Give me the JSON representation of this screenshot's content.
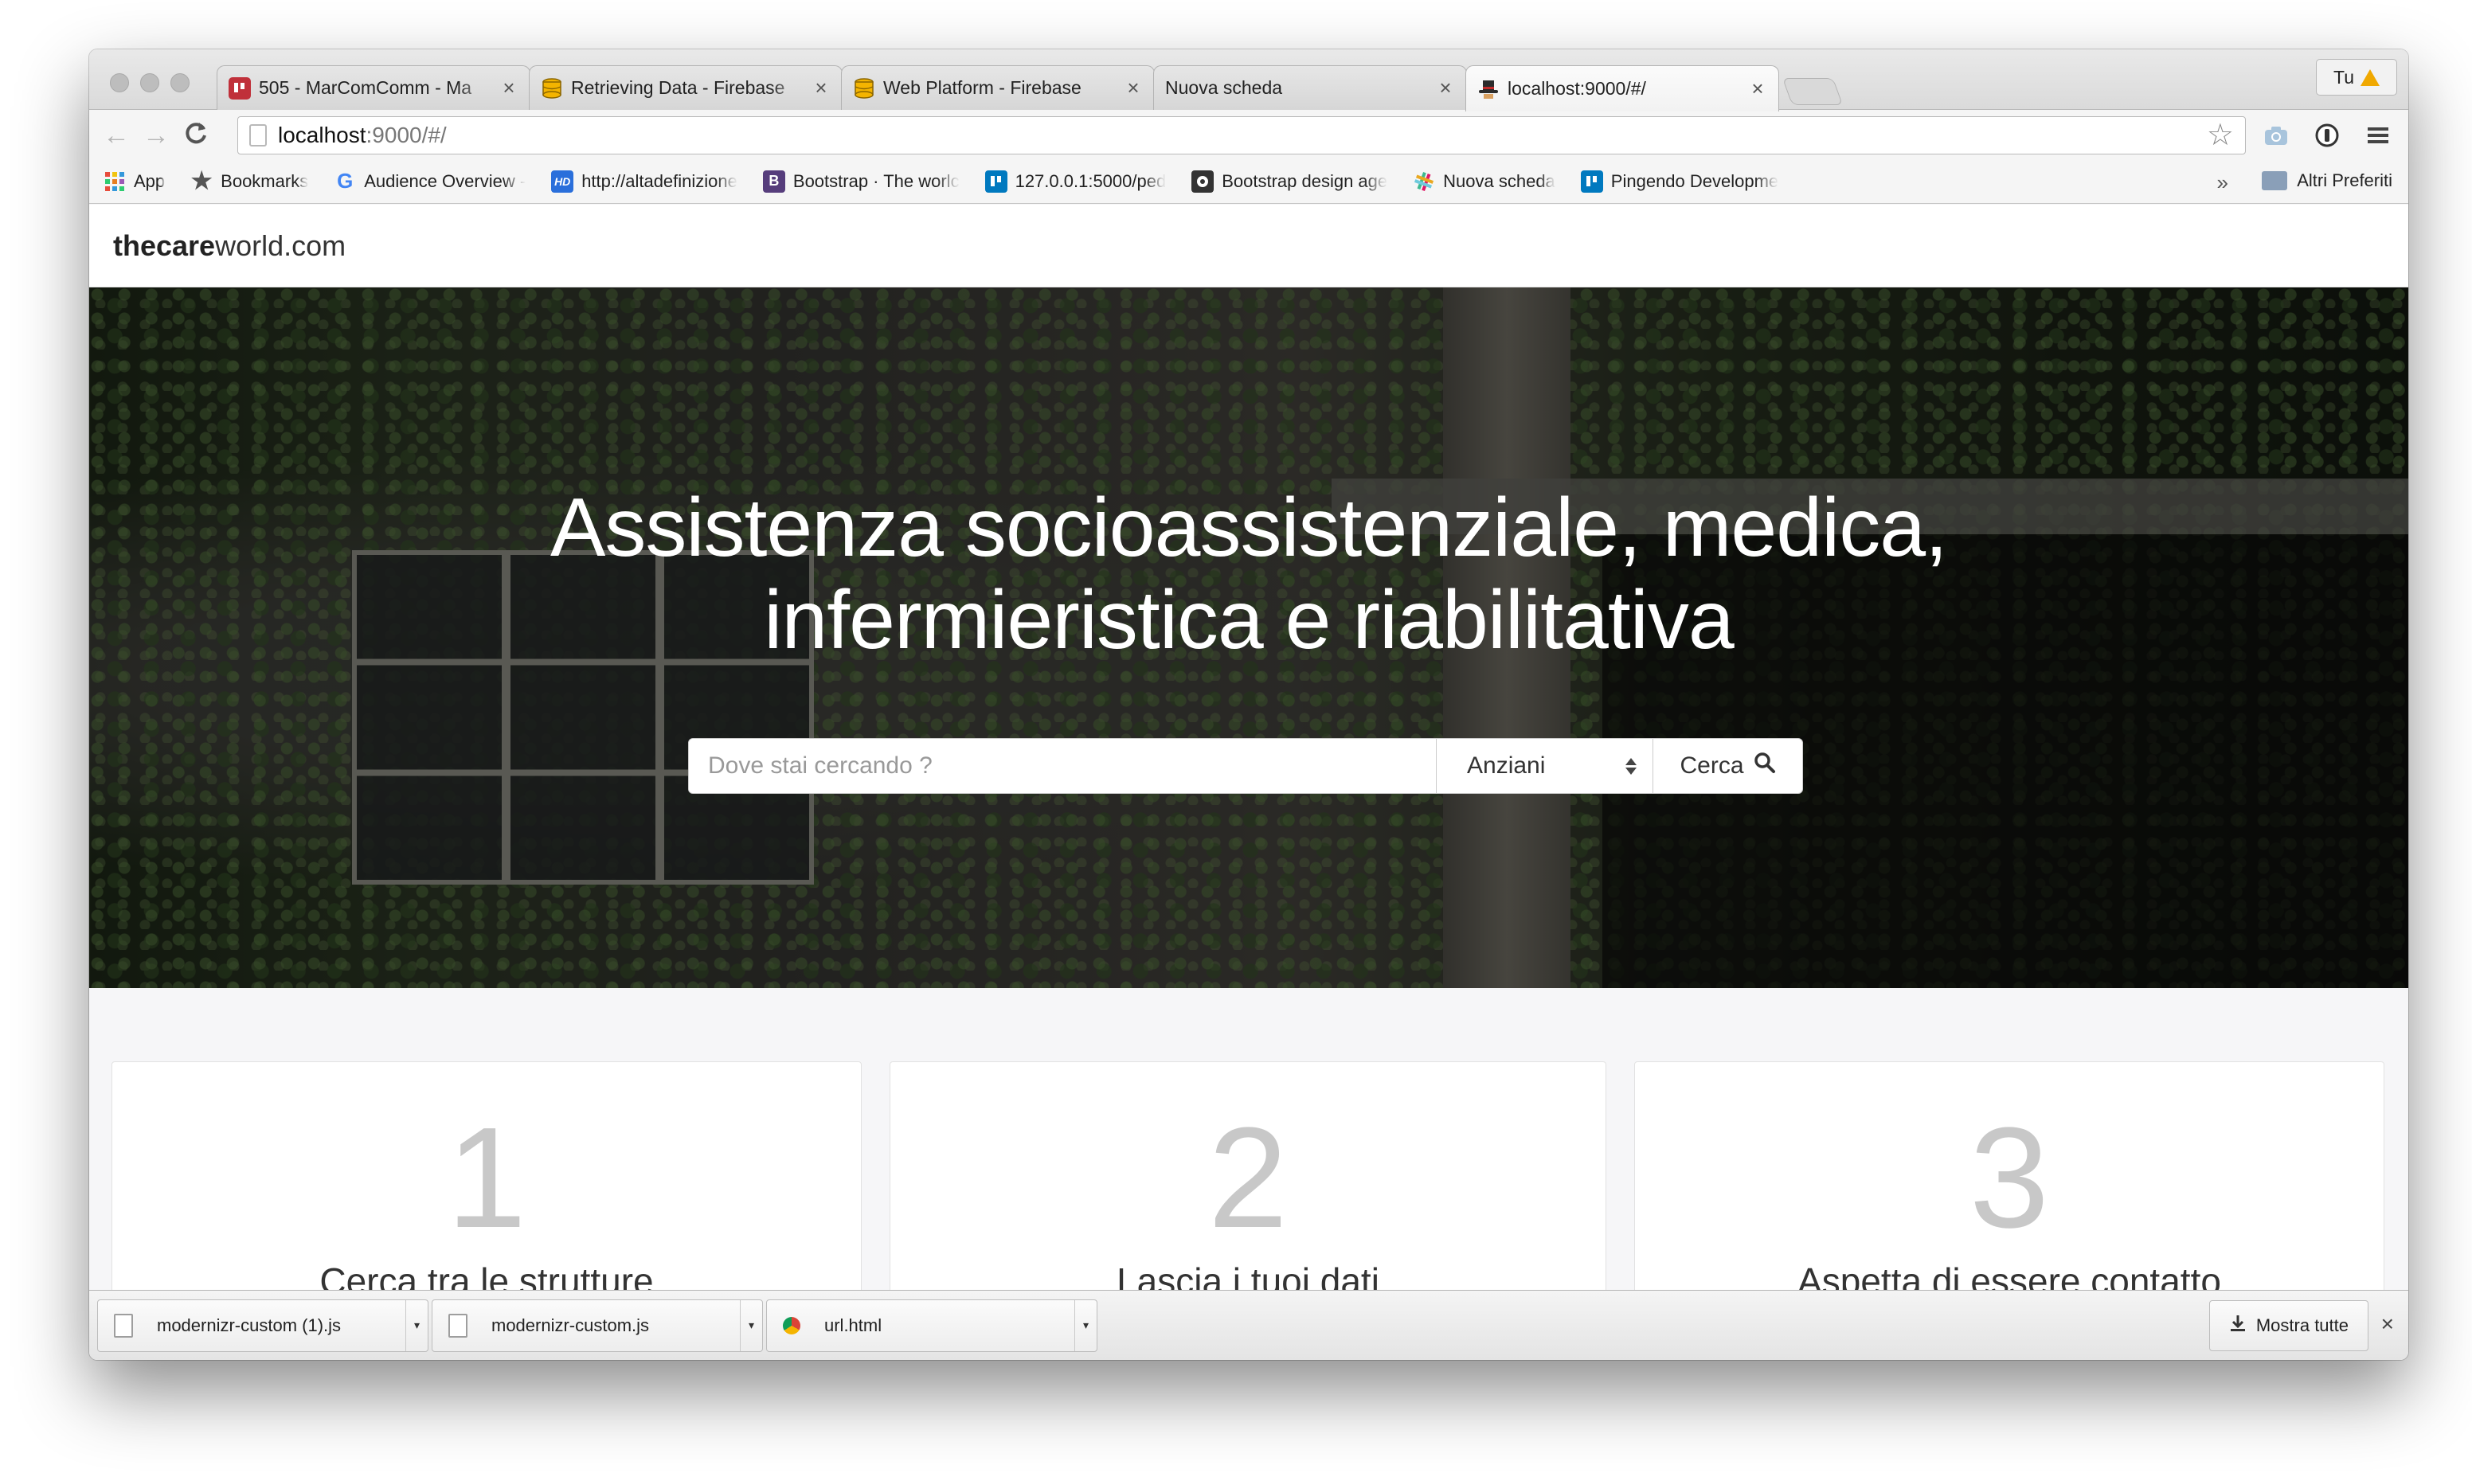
{
  "browser": {
    "tabs": [
      {
        "title": "505 - MarComComm - Ma",
        "favicon": "trello-icon",
        "color": "#c0303a",
        "active": false
      },
      {
        "title": "Retrieving Data - Firebase",
        "favicon": "firebase-icon",
        "color": "#f4b400",
        "active": false
      },
      {
        "title": "Web Platform - Firebase",
        "favicon": "firebase-icon",
        "color": "#f4b400",
        "active": false
      },
      {
        "title": "Nuova scheda",
        "favicon": "",
        "color": "",
        "active": false
      },
      {
        "title": "localhost:9000/#/",
        "favicon": "hat-icon",
        "color": "#c42a2a",
        "active": true
      }
    ],
    "profile_label": "Tu",
    "url_host": "localhost",
    "url_rest": ":9000/#/",
    "bookmarks": [
      {
        "label": "App",
        "icon": "apps-grid-icon"
      },
      {
        "label": "Bookmarks",
        "icon": "star-icon"
      },
      {
        "label": "Audience Overview -",
        "icon": "google-icon"
      },
      {
        "label": "http://altadefinizione",
        "icon": "hd-icon"
      },
      {
        "label": "Bootstrap · The worlc",
        "icon": "bootstrap-icon"
      },
      {
        "label": "127.0.0.1:5000/ped",
        "icon": "trello-icon"
      },
      {
        "label": "Bootstrap design age",
        "icon": "github-icon"
      },
      {
        "label": "Nuova scheda",
        "icon": "slack-icon"
      },
      {
        "label": "Pingendo Developme",
        "icon": "trello-icon"
      }
    ],
    "other_bookmarks": "Altri Preferiti"
  },
  "site": {
    "brand_bold": "thecare",
    "brand_rest": "world.com",
    "hero_title_line1": "Assistenza socioassistenziale, medica,",
    "hero_title_line2": "infermieristica e riabilitativa",
    "search_placeholder": "Dove stai cercando ?",
    "select_value": "Anziani",
    "search_button": "Cerca",
    "steps": [
      {
        "number": "1",
        "caption": "Cerca tra le strutture"
      },
      {
        "number": "2",
        "caption": "Lascia i tuoi dati"
      },
      {
        "number": "3",
        "caption": "Aspetta di essere contatto"
      }
    ]
  },
  "downloads": {
    "items": [
      "modernizr-custom (1).js",
      "modernizr-custom.js",
      "url.html"
    ],
    "show_all": "Mostra tutte"
  }
}
